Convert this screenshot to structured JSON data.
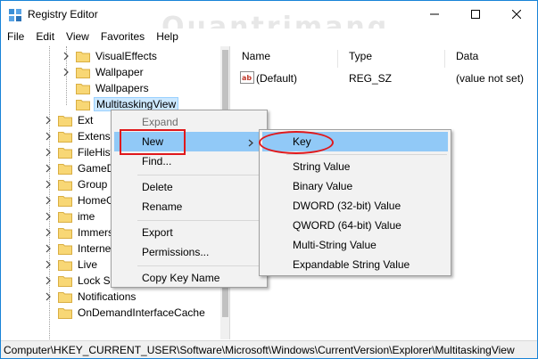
{
  "window": {
    "title": "Registry Editor"
  },
  "watermark": "Quantrimang",
  "menubar": [
    "File",
    "Edit",
    "View",
    "Favorites",
    "Help"
  ],
  "tree": [
    {
      "label": "VisualEffects",
      "expander": true,
      "selected": false
    },
    {
      "label": "Wallpaper",
      "expander": true,
      "selected": false
    },
    {
      "label": "Wallpapers",
      "expander": false,
      "selected": false
    },
    {
      "label": "MultitaskingView",
      "expander": false,
      "selected": true
    },
    {
      "label": "Ext",
      "expander": true,
      "selected": false
    },
    {
      "label": "Extensi",
      "expander": true,
      "selected": false
    },
    {
      "label": "FileHist",
      "expander": true,
      "selected": false
    },
    {
      "label": "GameD",
      "expander": true,
      "selected": false
    },
    {
      "label": "Group",
      "expander": true,
      "selected": false
    },
    {
      "label": "HomeG",
      "expander": true,
      "selected": false
    },
    {
      "label": "ime",
      "expander": true,
      "selected": false
    },
    {
      "label": "Immers",
      "expander": true,
      "selected": false
    },
    {
      "label": "Interne",
      "expander": true,
      "selected": false
    },
    {
      "label": "Live",
      "expander": true,
      "selected": false
    },
    {
      "label": "Lock Sc",
      "expander": true,
      "selected": false
    },
    {
      "label": "Notifications",
      "expander": true,
      "selected": false
    },
    {
      "label": "OnDemandInterfaceCache",
      "expander": false,
      "selected": false
    }
  ],
  "list": {
    "headers": {
      "name": "Name",
      "type": "Type",
      "data": "Data"
    },
    "rows": [
      {
        "name": "(Default)",
        "type": "REG_SZ",
        "data": "(value not set)",
        "icon": "string-value-icon"
      }
    ]
  },
  "context_menu": {
    "items": [
      {
        "label": "Expand",
        "disabled": true
      },
      {
        "label": "New",
        "highlight": true,
        "submenu": true
      },
      {
        "label": "Find..."
      },
      {
        "label": "Delete"
      },
      {
        "label": "Rename"
      },
      {
        "label": "Export"
      },
      {
        "label": "Permissions..."
      },
      {
        "label": "Copy Key Name"
      }
    ]
  },
  "submenu": {
    "items": [
      {
        "label": "Key",
        "highlight": true
      },
      {
        "label": "String Value"
      },
      {
        "label": "Binary Value"
      },
      {
        "label": "DWORD (32-bit) Value"
      },
      {
        "label": "QWORD (64-bit) Value"
      },
      {
        "label": "Multi-String Value"
      },
      {
        "label": "Expandable String Value"
      }
    ]
  },
  "statusbar": {
    "path": "Computer\\HKEY_CURRENT_USER\\Software\\Microsoft\\Windows\\CurrentVersion\\Explorer\\MultitaskingView"
  },
  "colors": {
    "accent": "#1883d7",
    "selection": "#cce8ff",
    "menu_highlight": "#91c9f7",
    "annotation": "#e0181b",
    "folder": "#f8d775"
  }
}
